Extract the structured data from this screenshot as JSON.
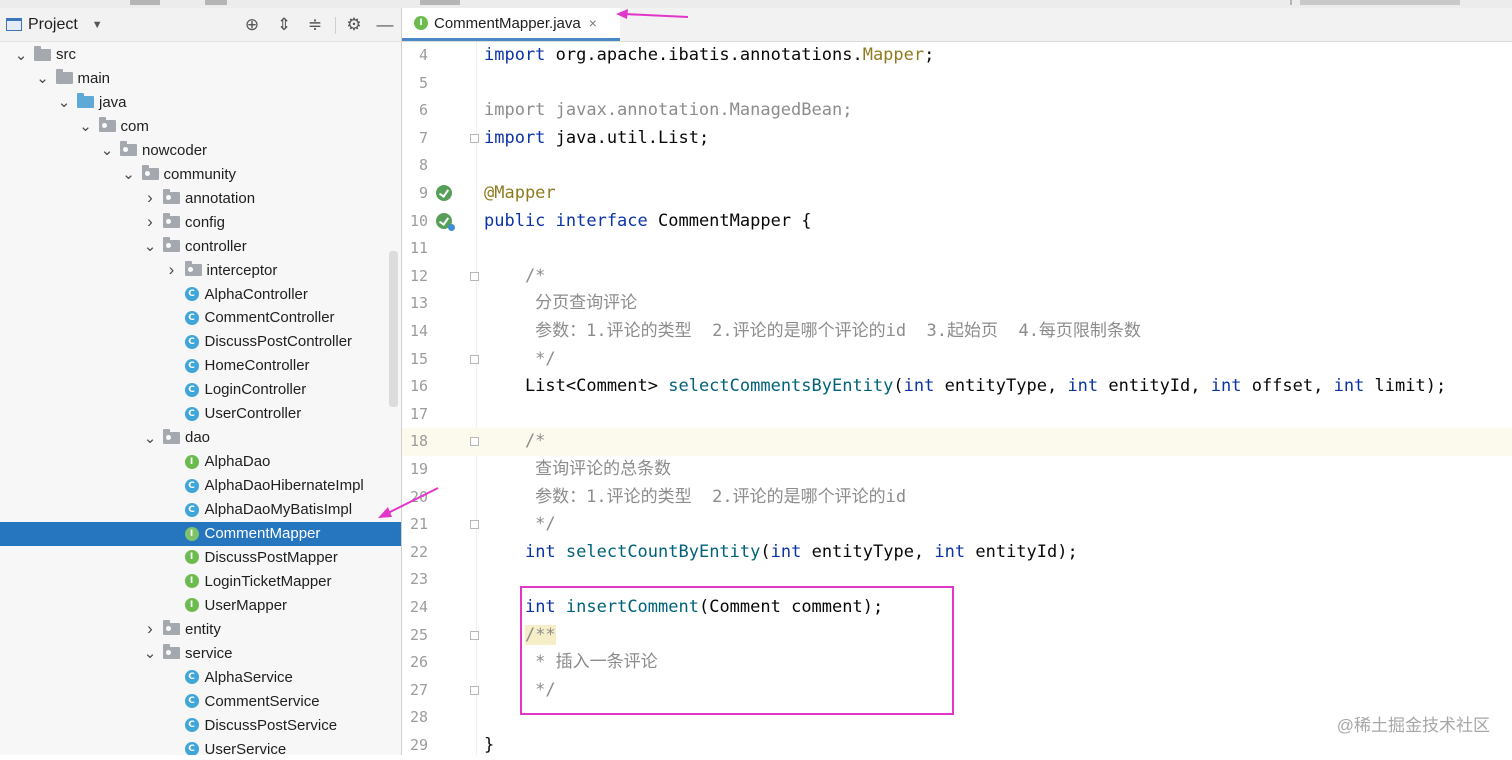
{
  "project_panel": {
    "title": "Project",
    "tree": [
      {
        "label": "src",
        "kind": "folder",
        "depth": 0,
        "expanded": true
      },
      {
        "label": "main",
        "kind": "folder",
        "depth": 1,
        "expanded": true
      },
      {
        "label": "java",
        "kind": "source-folder",
        "depth": 2,
        "expanded": true
      },
      {
        "label": "com",
        "kind": "package",
        "depth": 3,
        "expanded": true
      },
      {
        "label": "nowcoder",
        "kind": "package",
        "depth": 4,
        "expanded": true
      },
      {
        "label": "community",
        "kind": "package",
        "depth": 5,
        "expanded": true
      },
      {
        "label": "annotation",
        "kind": "package",
        "depth": 6,
        "expanded": false
      },
      {
        "label": "config",
        "kind": "package",
        "depth": 6,
        "expanded": false
      },
      {
        "label": "controller",
        "kind": "package",
        "depth": 6,
        "expanded": true
      },
      {
        "label": "interceptor",
        "kind": "package",
        "depth": 7,
        "expanded": false
      },
      {
        "label": "AlphaController",
        "kind": "class",
        "depth": 7
      },
      {
        "label": "CommentController",
        "kind": "class",
        "depth": 7
      },
      {
        "label": "DiscussPostController",
        "kind": "class",
        "depth": 7
      },
      {
        "label": "HomeController",
        "kind": "class",
        "depth": 7
      },
      {
        "label": "LoginController",
        "kind": "class",
        "depth": 7
      },
      {
        "label": "UserController",
        "kind": "class",
        "depth": 7
      },
      {
        "label": "dao",
        "kind": "package",
        "depth": 6,
        "expanded": true
      },
      {
        "label": "AlphaDao",
        "kind": "interface",
        "depth": 7
      },
      {
        "label": "AlphaDaoHibernateImpl",
        "kind": "class",
        "depth": 7
      },
      {
        "label": "AlphaDaoMyBatisImpl",
        "kind": "class",
        "depth": 7
      },
      {
        "label": "CommentMapper",
        "kind": "interface",
        "depth": 7,
        "selected": true
      },
      {
        "label": "DiscussPostMapper",
        "kind": "interface",
        "depth": 7
      },
      {
        "label": "LoginTicketMapper",
        "kind": "interface",
        "depth": 7
      },
      {
        "label": "UserMapper",
        "kind": "interface",
        "depth": 7
      },
      {
        "label": "entity",
        "kind": "package",
        "depth": 6,
        "expanded": false
      },
      {
        "label": "service",
        "kind": "package",
        "depth": 6,
        "expanded": true
      },
      {
        "label": "AlphaService",
        "kind": "class",
        "depth": 7
      },
      {
        "label": "CommentService",
        "kind": "class",
        "depth": 7
      },
      {
        "label": "DiscussPostService",
        "kind": "class",
        "depth": 7
      },
      {
        "label": "UserService",
        "kind": "class",
        "depth": 7
      }
    ]
  },
  "editor": {
    "tab": {
      "label": "CommentMapper.java",
      "close": "×"
    },
    "lines": [
      {
        "n": "4",
        "tokens": [
          [
            "k",
            "import "
          ],
          [
            "",
            "org.apache.ibatis.annotations."
          ],
          [
            "ann",
            "Mapper"
          ],
          [
            "",
            ";"
          ]
        ]
      },
      {
        "n": "5",
        "tokens": []
      },
      {
        "n": "6",
        "tokens": [
          [
            "cm",
            "import javax.annotation.ManagedBean;"
          ]
        ]
      },
      {
        "n": "7",
        "tokens": [
          [
            "k",
            "import "
          ],
          [
            "",
            "java.util.List;"
          ]
        ],
        "fold": true
      },
      {
        "n": "8",
        "tokens": []
      },
      {
        "n": "9",
        "tokens": [
          [
            "ann",
            "@Mapper"
          ]
        ],
        "gutter_icon": "mybatis-icon"
      },
      {
        "n": "10",
        "tokens": [
          [
            "k",
            "public interface "
          ],
          [
            "",
            "CommentMapper {"
          ]
        ],
        "gutter_icon": "mybatis-implemented-icon"
      },
      {
        "n": "11",
        "tokens": []
      },
      {
        "n": "12",
        "tokens": [
          [
            "cm",
            "    /*"
          ]
        ],
        "fold": true
      },
      {
        "n": "13",
        "tokens": [
          [
            "cm",
            "     分页查询评论"
          ]
        ]
      },
      {
        "n": "14",
        "tokens": [
          [
            "cm",
            "     参数：1.评论的类型  2.评论的是哪个评论的id  3.起始页  4.每页限制条数"
          ]
        ]
      },
      {
        "n": "15",
        "tokens": [
          [
            "cm",
            "     */"
          ]
        ],
        "fold": true
      },
      {
        "n": "16",
        "tokens": [
          [
            "",
            "    List<Comment> "
          ],
          [
            "fn",
            "selectCommentsByEntity"
          ],
          [
            "",
            "("
          ],
          [
            "k",
            "int "
          ],
          [
            "",
            "entityType, "
          ],
          [
            "k",
            "int "
          ],
          [
            "",
            "entityId, "
          ],
          [
            "k",
            "int "
          ],
          [
            "",
            "offset, "
          ],
          [
            "k",
            "int "
          ],
          [
            "",
            "limit);"
          ]
        ]
      },
      {
        "n": "17",
        "tokens": []
      },
      {
        "n": "18",
        "tokens": [
          [
            "cm",
            "    /*"
          ]
        ],
        "fold": true,
        "highlight": true
      },
      {
        "n": "19",
        "tokens": [
          [
            "cm",
            "     查询评论的总条数"
          ]
        ]
      },
      {
        "n": "20",
        "tokens": [
          [
            "cm",
            "     参数：1.评论的类型  2.评论的是哪个评论的id"
          ]
        ]
      },
      {
        "n": "21",
        "tokens": [
          [
            "cm",
            "     */"
          ]
        ],
        "fold": true
      },
      {
        "n": "22",
        "tokens": [
          [
            "",
            "    "
          ],
          [
            "k",
            "int "
          ],
          [
            "fn",
            "selectCountByEntity"
          ],
          [
            "",
            "("
          ],
          [
            "k",
            "int "
          ],
          [
            "",
            "entityType, "
          ],
          [
            "k",
            "int "
          ],
          [
            "",
            "entityId);"
          ]
        ]
      },
      {
        "n": "23",
        "tokens": []
      },
      {
        "n": "24",
        "tokens": [
          [
            "",
            "    "
          ],
          [
            "k",
            "int "
          ],
          [
            "fn",
            "insertComment"
          ],
          [
            "",
            "(Comment comment);"
          ]
        ]
      },
      {
        "n": "25",
        "tokens": [
          [
            "",
            "    "
          ],
          [
            "cmh",
            "/**"
          ]
        ],
        "fold": true
      },
      {
        "n": "26",
        "tokens": [
          [
            "cm",
            "     * 插入一条评论"
          ]
        ]
      },
      {
        "n": "27",
        "tokens": [
          [
            "cm",
            "     */"
          ]
        ],
        "fold": true
      },
      {
        "n": "28",
        "tokens": []
      },
      {
        "n": "29",
        "tokens": [
          [
            "",
            "}"
          ]
        ]
      }
    ]
  },
  "watermark": "@稀土掘金技术社区",
  "colors": {
    "selection": "#2675bf",
    "keyword": "#0b33a8",
    "annotation": "#8f7b1d",
    "method": "#00627a",
    "comment": "#8c8c8c",
    "marker": "#e236c9"
  }
}
